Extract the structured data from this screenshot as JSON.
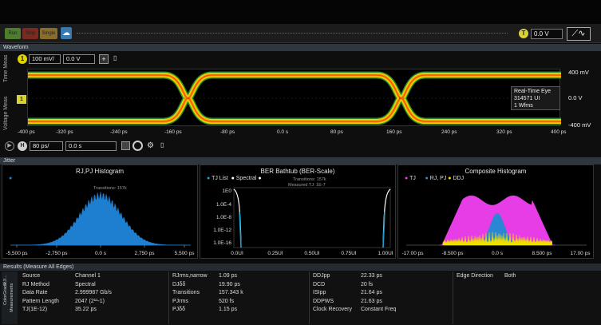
{
  "toolbar": {
    "run_label": "Run",
    "stop_label": "Stop",
    "single_label": "Single",
    "trigger_badge": "T",
    "trigger_level": "0.0 V"
  },
  "waveform": {
    "panel_title": "Waveform",
    "tab_time_meas": "Time Meas",
    "tab_voltage_meas": "Voltage Meas",
    "channel_badge": "1",
    "ref_marker": "1",
    "vertical_scale": "100 mV/",
    "vertical_offset": "0.0 V",
    "plus_label": "+",
    "y_labels": {
      "top": "400 mV",
      "mid": "0.0 V",
      "bottom": "-400 mV"
    },
    "eye_info": [
      "Real-Time Eye",
      "314571 UI",
      "1 Wfms"
    ],
    "x_ticks": [
      "-400 ps",
      "-320 ps",
      "-240 ps",
      "-160 ps",
      "-80 ps",
      "0.0 s",
      "80 ps",
      "160 ps",
      "240 ps",
      "320 ps",
      "400 ps"
    ],
    "horizontal_badge": "H",
    "horizontal_scale": "80 ps/",
    "horizontal_position": "0.0 s",
    "colors": {
      "eye_hot": "#ff4a00",
      "eye_mid": "#f2a900",
      "eye_cool": "#e8d600",
      "eye_noise": "#33a83a"
    }
  },
  "jitter": {
    "panel_title": "Jitter",
    "rjpj": {
      "title": "RJ,PJ Histogram",
      "note": "Transitions: 157k",
      "x_ticks": [
        "-5,500 ps",
        "-2,750 ps",
        "0.0 s",
        "2,750 ps",
        "5,500 ps"
      ],
      "color": "#1e7fd0"
    },
    "ber": {
      "title": "BER Bathtub (BER-Scale)",
      "legend": [
        "TJ List",
        "Spectral"
      ],
      "notes": [
        "Transitions: 157k",
        "Measured TJ: 1E-7"
      ],
      "y_ticks": [
        "1E0",
        "1.0E-4",
        "1.0E-8",
        "1.0E-12",
        "1.0E-16"
      ],
      "x_ticks": [
        "0.0UI",
        "0.25UI",
        "0.50UI",
        "0.75UI",
        "1.00UI"
      ],
      "colors": {
        "tj": "#1aa0d6",
        "spectral": "#ffffff"
      }
    },
    "composite": {
      "title": "Composite Histogram",
      "legend": [
        "TJ",
        "RJ, PJ",
        "DDJ"
      ],
      "x_ticks": [
        "-17.00 ps",
        "-8.500 ps",
        "0.0 s",
        "8.500 ps",
        "17.00 ps"
      ],
      "colors": {
        "tj": "#e63de6",
        "rjpj": "#2b86d6",
        "ddj": "#f0e000"
      }
    }
  },
  "results": {
    "header": "Results  (Measure All Edges)",
    "tabs": [
      "RJ/...",
      "ColorGrade",
      "Measurements"
    ],
    "col1": [
      [
        "Source",
        "Channel 1"
      ],
      [
        "RJ Method",
        "Spectral"
      ],
      [
        "Data Rate",
        "2.999987 Gb/s"
      ],
      [
        "Pattern Length",
        "2047 (2¹¹-1)"
      ],
      [
        "TJ(1E-12)",
        "35.22 ps"
      ]
    ],
    "col2": [
      [
        "RJrms,narrow",
        "1.09 ps"
      ],
      [
        "DJδδ",
        "19.90 ps"
      ],
      [
        "Transitions",
        "157.343 k"
      ],
      [
        "PJrms",
        "520 fs"
      ],
      [
        "PJδδ",
        "1.15 ps"
      ]
    ],
    "col3": [
      [
        "DDJpp",
        "22.33 ps"
      ],
      [
        "DCD",
        "20 fs"
      ],
      [
        "ISIpp",
        "21.64 ps"
      ],
      [
        "DDPWS",
        "21.63 ps"
      ],
      [
        "Clock Recovery",
        "Constant Freq"
      ]
    ],
    "col4": [
      [
        "Edge Direction",
        "Both"
      ]
    ]
  }
}
